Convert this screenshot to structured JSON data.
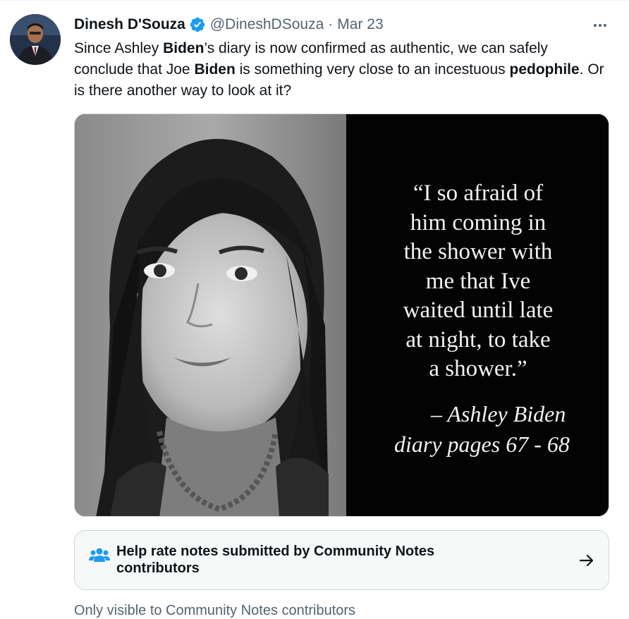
{
  "tweet": {
    "author_name": "Dinesh D'Souza",
    "author_handle": "@DineshDSouza",
    "separator": "·",
    "date": "Mar 23",
    "text_parts": [
      "Since Ashley ",
      "Biden",
      "’s diary is now confirmed as authentic, we can safely conclude that Joe ",
      "Biden",
      " is something very close to an incestuous ",
      "pedophile",
      ". Or is there another way to look at it?"
    ]
  },
  "media": {
    "quote_lines": [
      "“I so afraid of",
      "him coming in",
      "the shower with",
      "me that Ive",
      "waited until late",
      "at night, to take",
      "a shower.”"
    ],
    "attribution_line1": "– Ashley Biden",
    "attribution_line2": "diary pages 67 - 68"
  },
  "community_notes": {
    "prompt": "Help rate notes submitted by Community Notes contributors",
    "visibility": "Only visible to Community Notes contributors"
  },
  "colors": {
    "verified": "#1d9bf0",
    "notes_icon": "#1d9bf0",
    "muted_text": "#536471"
  },
  "icons": {
    "verified": "verified-badge-icon",
    "more": "more-options-icon",
    "notes": "community-notes-people-icon",
    "arrow": "arrow-right-icon"
  }
}
